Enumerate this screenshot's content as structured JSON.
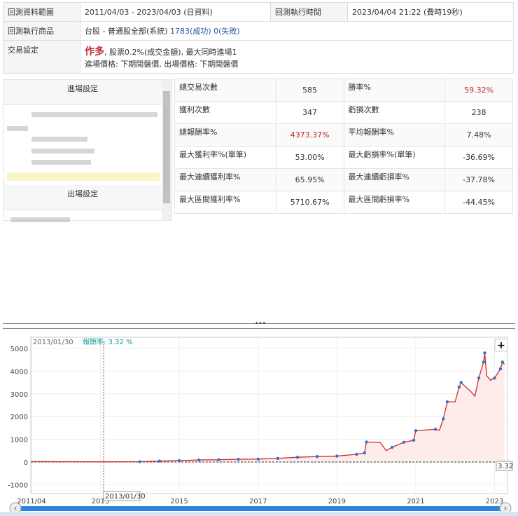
{
  "info": {
    "range_label": "回測資料範圍",
    "range_value": "2011/04/03 - 2023/04/03 (日資料)",
    "time_label": "回測執行時間",
    "time_value": "2023/04/04 21:22 (費時19秒)",
    "product_label": "回測執行商品",
    "product_value": "台股 - 普通股全部(系統)",
    "success": "1783(成功)",
    "fail": "0(失敗)",
    "trade_label": "交易設定",
    "trade_direction": "作多",
    "trade_detail": ", 股票0.2%(成交金額), 最大同時進場1",
    "trade_prices": "進場價格: 下期開盤價, 出場價格: 下期開盤價"
  },
  "settings": {
    "entry": "進場設定",
    "exit": "出場設定"
  },
  "stats": [
    [
      {
        "k": "總交易次數",
        "v": "585"
      },
      {
        "k": "勝率%",
        "v": "59.32%",
        "red": true
      }
    ],
    [
      {
        "k": "獲利次數",
        "v": "347"
      },
      {
        "k": "虧損次數",
        "v": "238"
      }
    ],
    [
      {
        "k": "總報酬率%",
        "v": "4373.37%",
        "red": true
      },
      {
        "k": "平均報酬率%",
        "v": "7.48%"
      }
    ],
    [
      {
        "k": "最大獲利率%(單筆)",
        "v": "53.00%"
      },
      {
        "k": "最大虧損率%(單筆)",
        "v": "-36.69%"
      }
    ],
    [
      {
        "k": "最大連續獲利率%",
        "v": "65.95%"
      },
      {
        "k": "最大連續虧損率%",
        "v": "-37.78%"
      }
    ],
    [
      {
        "k": "最大區間獲利率%",
        "v": "5710.67%"
      },
      {
        "k": "最大區間虧損率%",
        "v": "-44.45%"
      }
    ]
  ],
  "splitter": "•••",
  "chart_data": {
    "type": "line",
    "tooltip_date": "2013/01/30",
    "tooltip_label": "報酬率: 3.32 %",
    "crosshair_date": "2013/01/30",
    "last_value_label": "3.32",
    "zoom_button": "+",
    "ylim": [
      -1000,
      5000
    ],
    "yticks": [
      "-1000",
      "0",
      "1000",
      "2000",
      "3000",
      "4000",
      "5000"
    ],
    "xticks": [
      {
        "x": 2011.25,
        "label": "2011/04"
      },
      {
        "x": 2013,
        "label": "2013"
      },
      {
        "x": 2015,
        "label": "2015"
      },
      {
        "x": 2017,
        "label": "2017"
      },
      {
        "x": 2019,
        "label": "2019"
      },
      {
        "x": 2021,
        "label": "2021"
      },
      {
        "x": 2023,
        "label": "2023"
      }
    ],
    "colors": {
      "line": "#d62728",
      "fill": "#fdecea",
      "marker": "#2a78c8"
    },
    "series": [
      [
        2011.25,
        20
      ],
      [
        2013,
        10
      ],
      [
        2014,
        15
      ],
      [
        2014.5,
        40
      ],
      [
        2015,
        60
      ],
      [
        2015.5,
        90
      ],
      [
        2016,
        100
      ],
      [
        2016.5,
        120
      ],
      [
        2017,
        130
      ],
      [
        2017.5,
        160
      ],
      [
        2018,
        210
      ],
      [
        2018.5,
        240
      ],
      [
        2019,
        260
      ],
      [
        2019.5,
        340
      ],
      [
        2019.7,
        400
      ],
      [
        2019.75,
        880
      ],
      [
        2020.1,
        860
      ],
      [
        2020.25,
        500
      ],
      [
        2020.4,
        650
      ],
      [
        2020.7,
        870
      ],
      [
        2020.95,
        960
      ],
      [
        2021,
        1380
      ],
      [
        2021.5,
        1440
      ],
      [
        2021.6,
        1400
      ],
      [
        2021.7,
        1900
      ],
      [
        2021.8,
        2650
      ],
      [
        2022,
        2650
      ],
      [
        2022.1,
        3300
      ],
      [
        2022.15,
        3500
      ],
      [
        2022.4,
        3100
      ],
      [
        2022.5,
        2900
      ],
      [
        2022.6,
        3700
      ],
      [
        2022.72,
        4400
      ],
      [
        2022.75,
        4800
      ],
      [
        2022.8,
        3800
      ],
      [
        2022.9,
        3600
      ],
      [
        2023,
        3700
      ],
      [
        2023.15,
        4100
      ],
      [
        2023.2,
        4400
      ],
      [
        2023.25,
        4300
      ]
    ]
  }
}
